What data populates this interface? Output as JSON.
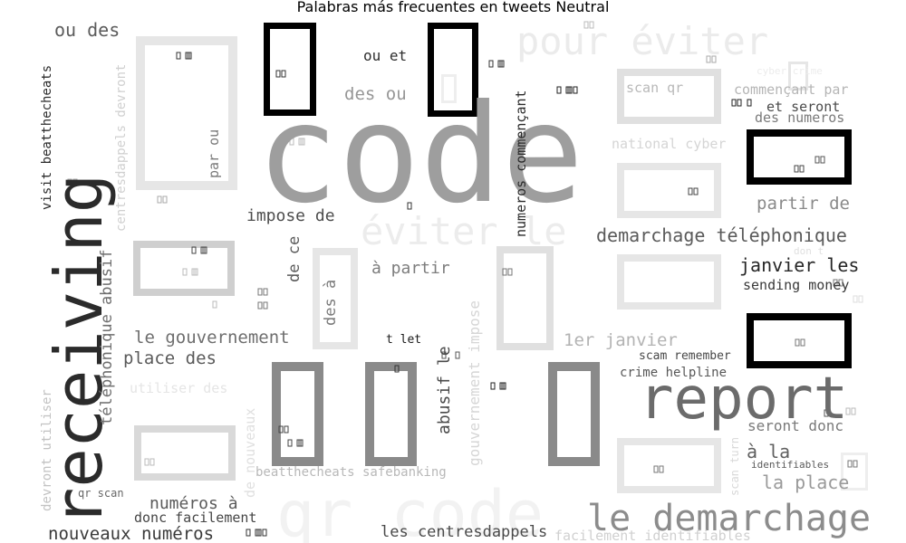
{
  "chart_data": {
    "type": "wordcloud",
    "title": "Palabras más frecuentes en tweets Neutral",
    "colormap": "gray",
    "glyph_placeholder": "▯",
    "words": [
      {
        "text": "code",
        "shade": "#9e9e9e"
      },
      {
        "text": "receiving",
        "shade": "#2b2b2b"
      },
      {
        "text": "report",
        "shade": "#6b6b6b"
      },
      {
        "text": "qr code",
        "shade": "#f2f2f2"
      },
      {
        "text": "le demarchage",
        "shade": "#8c8c8c"
      },
      {
        "text": "pour éviter",
        "shade": "#ebebeb"
      },
      {
        "text": "éviter le",
        "shade": "#ececec"
      },
      {
        "text": "demarchage téléphonique",
        "shade": "#5a5a5a"
      },
      {
        "text": "janvier les",
        "shade": "#262626"
      },
      {
        "text": "sending money",
        "shade": "#3a3a3a"
      },
      {
        "text": "partir de",
        "shade": "#8a8a8a"
      },
      {
        "text": "impose de",
        "shade": "#4d4d4d"
      },
      {
        "text": "à partir",
        "shade": "#7d7d7d"
      },
      {
        "text": "le gouvernement",
        "shade": "#6e6e6e"
      },
      {
        "text": "place des",
        "shade": "#5a5a5a"
      },
      {
        "text": "1er janvier",
        "shade": "#b3b3b3"
      },
      {
        "text": "ou des",
        "shade": "#5c5c5c"
      },
      {
        "text": "ou et",
        "shade": "#2e2e2e"
      },
      {
        "text": "des ou",
        "shade": "#969696"
      },
      {
        "text": "scan qr",
        "shade": "#b8b8b8"
      },
      {
        "text": "commençant par",
        "shade": "#b5b5b5"
      },
      {
        "text": "et seront",
        "shade": "#4a4a4a"
      },
      {
        "text": "des numeros",
        "shade": "#7a7a7a"
      },
      {
        "text": "national cyber",
        "shade": "#d5d5d5"
      },
      {
        "text": "cyber crime",
        "shade": "#ececec"
      },
      {
        "text": "numéros à",
        "shade": "#5a5a5a"
      },
      {
        "text": "donc facilement",
        "shade": "#454545"
      },
      {
        "text": "nouveaux numéros",
        "shade": "#3a3a3a"
      },
      {
        "text": "les centresdappels",
        "shade": "#4a4a4a"
      },
      {
        "text": "facilement identifiables",
        "shade": "#d0d0d0"
      },
      {
        "text": "la place",
        "shade": "#9a9a9a"
      },
      {
        "text": "à la",
        "shade": "#606060"
      },
      {
        "text": "seront donc",
        "shade": "#7a7a7a"
      },
      {
        "text": "crime helpline",
        "shade": "#585858"
      },
      {
        "text": "scam remember",
        "shade": "#484848"
      },
      {
        "text": "identifiables",
        "shade": "#5a5a5a"
      },
      {
        "text": "beatthecheats safebanking",
        "shade": "#b8b8b8"
      },
      {
        "text": "utiliser des",
        "shade": "#e5e5e5"
      },
      {
        "text": "qr scan",
        "shade": "#666666"
      },
      {
        "text": "t let",
        "shade": "#1a1a1a"
      },
      {
        "text": "don t",
        "shade": "#e0e0e0"
      },
      {
        "text": "visit beatthecheats",
        "shade": "#2b2b2b"
      },
      {
        "text": "centresdappels devront",
        "shade": "#d0d0d0"
      },
      {
        "text": "par ou",
        "shade": "#7a7a7a"
      },
      {
        "text": "téléphonique abusif",
        "shade": "#6e6e6e"
      },
      {
        "text": "de ce",
        "shade": "#5a5a5a"
      },
      {
        "text": "des à",
        "shade": "#7a7a7a"
      },
      {
        "text": "abusif le",
        "shade": "#4a4a4a"
      },
      {
        "text": "gouvernement impose",
        "shade": "#d6d6d6"
      },
      {
        "text": "numeros commençant",
        "shade": "#2b2b2b"
      },
      {
        "text": "devront utiliser",
        "shade": "#c2c2c2"
      },
      {
        "text": "de nouveaux",
        "shade": "#e0e0e0"
      },
      {
        "text": "scan turn",
        "shade": "#d8d8d8"
      }
    ],
    "glyph_boxes": [
      {
        "shade": "#e6e6e6"
      },
      {
        "shade": "#000000"
      },
      {
        "shade": "#000000"
      },
      {
        "shade": "#000000"
      },
      {
        "shade": "#000000"
      },
      {
        "shade": "#cfcfcf"
      },
      {
        "shade": "#e6e6e6"
      },
      {
        "shade": "#e0e0e0"
      },
      {
        "shade": "#e0e0e0"
      },
      {
        "shade": "#e6e6e6"
      },
      {
        "shade": "#e6e6e6"
      },
      {
        "shade": "#8a8a8a"
      },
      {
        "shade": "#8a8a8a"
      },
      {
        "shade": "#8a8a8a"
      },
      {
        "shade": "#d9d9d9"
      },
      {
        "shade": "#e6e6e6"
      },
      {
        "shade": "#eeeeee"
      },
      {
        "shade": "#e6e6e6"
      },
      {
        "shade": "#eeeeee"
      }
    ]
  }
}
